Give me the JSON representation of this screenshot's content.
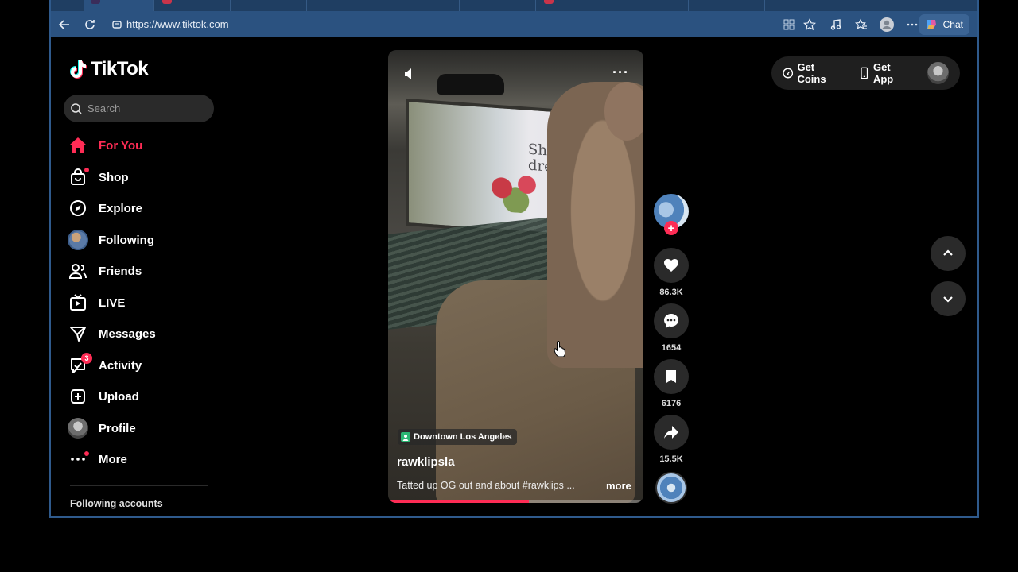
{
  "browser": {
    "url": "https://www.tiktok.com",
    "chat_label": "Chat",
    "accent": "#2b5280"
  },
  "sidebar": {
    "logo_text": "TikTok",
    "search_placeholder": "Search",
    "items": [
      {
        "label": "For You",
        "icon": "home-icon",
        "active": true
      },
      {
        "label": "Shop",
        "icon": "shop-bag-icon",
        "dot": true
      },
      {
        "label": "Explore",
        "icon": "compass-icon"
      },
      {
        "label": "Following",
        "icon": "following-avatar"
      },
      {
        "label": "Friends",
        "icon": "friends-icon"
      },
      {
        "label": "LIVE",
        "icon": "live-tv-icon"
      },
      {
        "label": "Messages",
        "icon": "send-icon"
      },
      {
        "label": "Activity",
        "icon": "activity-icon",
        "badge": "3"
      },
      {
        "label": "Upload",
        "icon": "upload-plus-icon"
      },
      {
        "label": "Profile",
        "icon": "profile-avatar"
      },
      {
        "label": "More",
        "icon": "more-dots-icon",
        "dot": true
      }
    ],
    "following_accounts_label": "Following accounts",
    "accent": "#fe2c55"
  },
  "video": {
    "location": "Downtown Los Angeles",
    "author": "rawklipsla",
    "caption": "Tatted up OG out and about #rawklips ...",
    "more_label": "more",
    "billboard_text_line1": "She dar",
    "billboard_text_line2": "dreams",
    "progress_fraction": 0.55
  },
  "actions": {
    "likes": "86.3K",
    "comments": "1654",
    "saves": "6176",
    "shares": "15.5K"
  },
  "topbar": {
    "get_coins": "Get Coins",
    "get_app": "Get App"
  }
}
